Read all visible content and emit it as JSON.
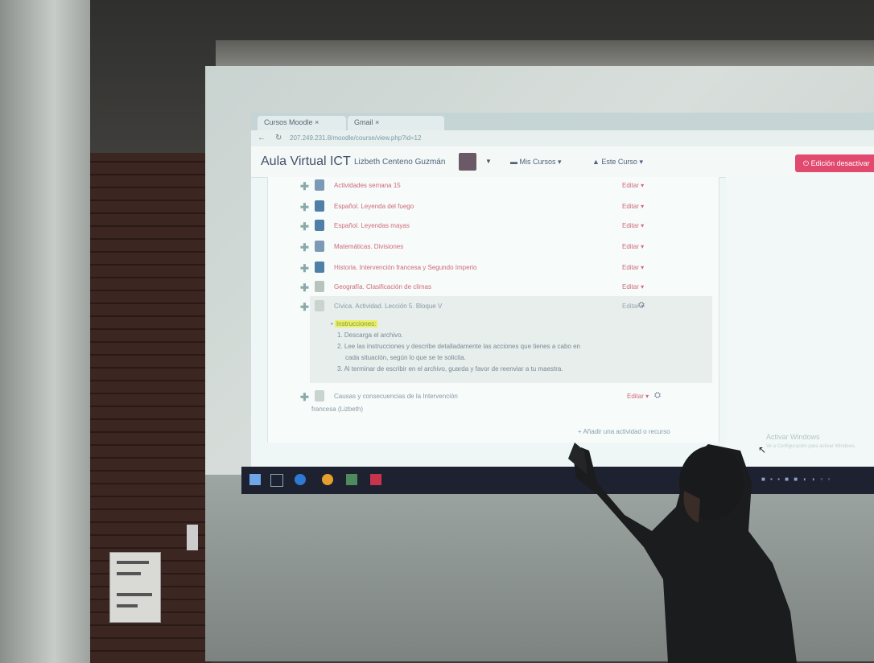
{
  "browser": {
    "tabs": [
      "Cursos Moodle ×",
      "Gmail ×"
    ],
    "address": "207.249.231.8/moodle/course/view.php?id=12"
  },
  "topbar": {
    "brand": "Aula Virtual ICT",
    "user": "Lizbeth Centeno Guzmán",
    "menu_courses": "Mis Cursos",
    "menu_this_course": "Este Curso",
    "edit_button": "Edición desactivar"
  },
  "activities": [
    {
      "title": "Actividades semana 15",
      "edit": "Editar",
      "icon": "forum-icon",
      "color": "red"
    },
    {
      "title": "Español. Leyenda del fuego",
      "edit": "Editar",
      "icon": "file-icon",
      "color": "red"
    },
    {
      "title": "Español. Leyendas mayas",
      "edit": "Editar",
      "icon": "file-icon",
      "color": "red"
    },
    {
      "title": "Matemáticas. Divisiones",
      "edit": "Editar",
      "icon": "forum-icon",
      "color": "red"
    },
    {
      "title": "Historia. Intervención francesa y Segundo Imperio",
      "edit": "Editar",
      "icon": "file-icon",
      "color": "red"
    },
    {
      "title": "Geografía. Clasificación de climas",
      "edit": "Editar",
      "icon": "page-icon",
      "color": "red"
    },
    {
      "title": "Cívica. Actividad. Lección 5. Bloque V",
      "edit": "Editar",
      "icon": "page-icon",
      "color": "gray"
    }
  ],
  "instructions": {
    "heading": "Instrucciones:",
    "lines": [
      "1. Descarga el archivo.",
      "2. Lee las instrucciones y describe detalladamente las acciones que tienes a cabo en",
      "cada situación, según lo que se te solicita.",
      "3. Al terminar de escribir en el archivo, guarda y favor de reenviar a tu maestra."
    ]
  },
  "last_activity": {
    "title_line1": "Causas y consecuencias de la Intervención",
    "title_line2": "francesa     (Lizbeth)",
    "edit": "Editar"
  },
  "add_activity": "+ Añadir una actividad o recurso",
  "watermark": {
    "line1": "Activar Windows",
    "line2": "Ve a Configuración para activar Windows."
  },
  "colors": {
    "accent_red": "#d06a7a",
    "button_pink": "#e14a6e",
    "highlight": "#e9f06a"
  }
}
